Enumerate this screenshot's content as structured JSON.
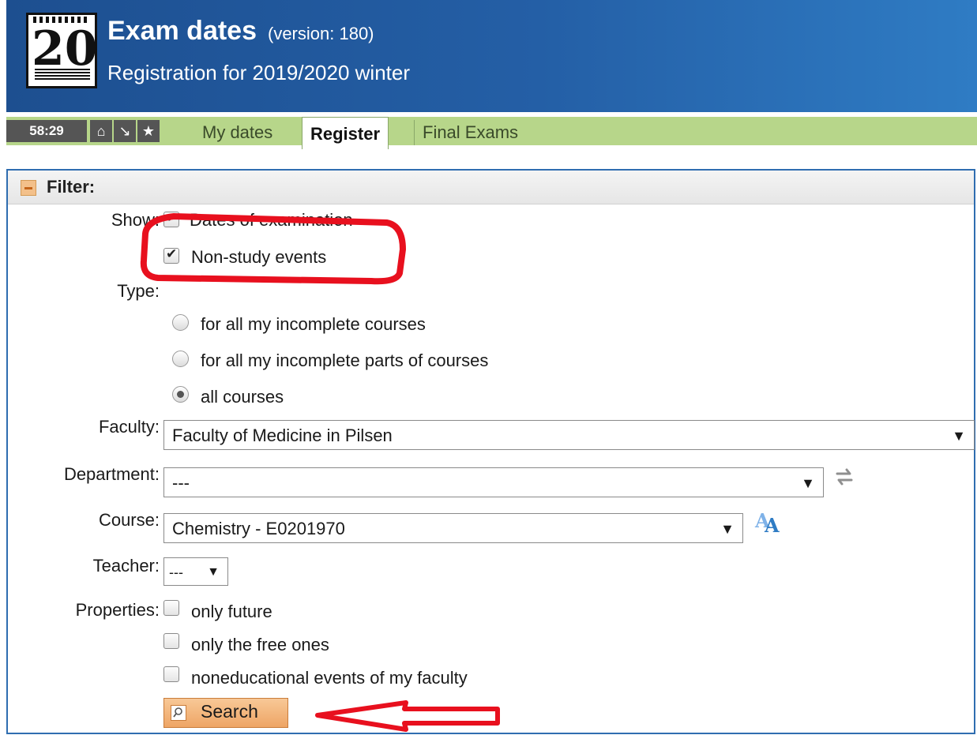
{
  "header": {
    "title": "Exam dates",
    "version": "(version: 180)",
    "subtitle": "Registration for 2019/2020 winter",
    "icon_number": "20",
    "bg_color": "#245fa6"
  },
  "tabbar": {
    "timer": "58:29",
    "icons": [
      "home-icon",
      "download-icon",
      "star-icon"
    ],
    "tabs": [
      {
        "label": "My dates",
        "active": false
      },
      {
        "label": "Register",
        "active": true
      },
      {
        "label": "Final Exams",
        "active": false
      }
    ],
    "bg_color": "#b7d68a"
  },
  "filter": {
    "title": "Filter:",
    "show": {
      "label": "Show:",
      "options": [
        {
          "label": "Dates of examination",
          "checked": true
        },
        {
          "label": "Non-study events",
          "checked": true
        }
      ]
    },
    "type": {
      "label": "Type:",
      "options": [
        {
          "label": "for all my incomplete courses",
          "selected": false
        },
        {
          "label": "for all my incomplete parts of courses",
          "selected": false
        },
        {
          "label": "all courses",
          "selected": true
        }
      ]
    },
    "faculty": {
      "label": "Faculty:",
      "value": "Faculty of Medicine in Pilsen"
    },
    "department": {
      "label": "Department:",
      "value": "---"
    },
    "course": {
      "label": "Course:",
      "value": "Chemistry - E0201970"
    },
    "teacher": {
      "label": "Teacher:",
      "value": "---"
    },
    "properties": {
      "label": "Properties:",
      "options": [
        {
          "label": "only future",
          "checked": false
        },
        {
          "label": "only the free ones",
          "checked": false
        },
        {
          "label": "noneducational events of my faculty",
          "checked": false
        }
      ]
    },
    "search_label": "Search"
  },
  "annotations": {
    "color": "#e8101e"
  }
}
